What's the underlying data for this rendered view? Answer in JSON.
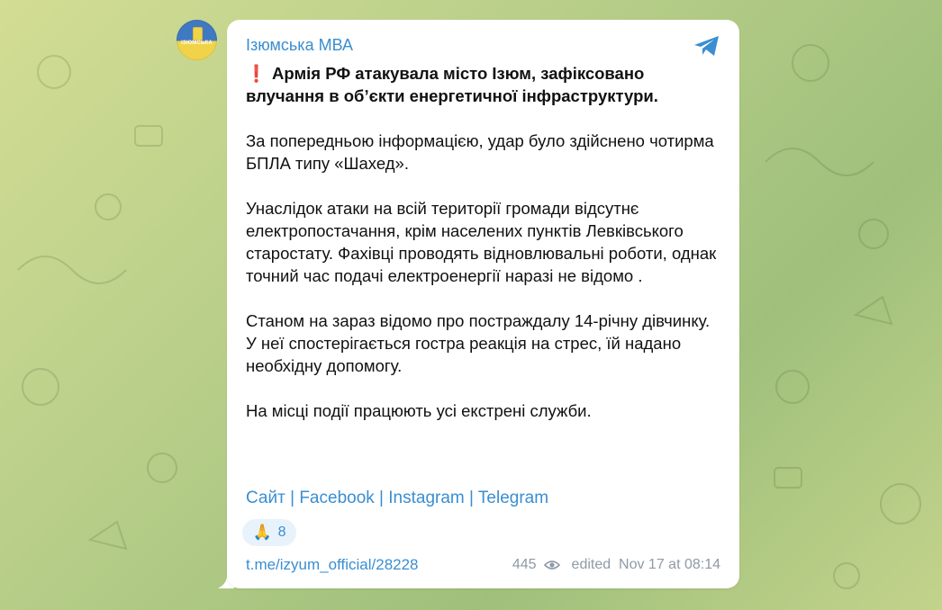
{
  "channel": {
    "name": "Ізюмська МВА",
    "avatar_text": "ІЗЮМСЬКА"
  },
  "post": {
    "headline": "Армія РФ атакувала місто Ізюм, зафіксовано влучання в обʼєкти енергетичної інфраструктури.",
    "paragraphs": [
      "За попередньою інформацією, удар було здійснено чотирма БПЛА типу «Шахед».",
      "Унаслідок атаки на всій території громади відсутнє електропостачання, крім населених пунктів Левківського старостату. Фахівці проводять відновлювальні роботи, однак точний час подачі електроенергії наразі не відомо .",
      "Станом на зараз відомо про постраждалу 14-річну дівчинку. У неї спостерігається гостра реакція на стрес, їй надано необхідну допомогу.",
      "На місці події працюють усі екстрені служби."
    ],
    "links": [
      "Сайт",
      "Facebook",
      "Instagram",
      "Telegram"
    ],
    "link_separator": " | ",
    "reaction": {
      "emoji": "🙏",
      "count": "8"
    },
    "url": "t.me/izyum_official/28228",
    "views": "445",
    "timestamp": "edited  Nov 17 at 08:14"
  },
  "icons": {
    "share": "telegram-share-icon",
    "views": "eye-icon",
    "alert": "exclamation-icon"
  },
  "colors": {
    "accent": "#3a8ed1",
    "alert": "#d8262b",
    "meta": "#8f9aa5"
  }
}
